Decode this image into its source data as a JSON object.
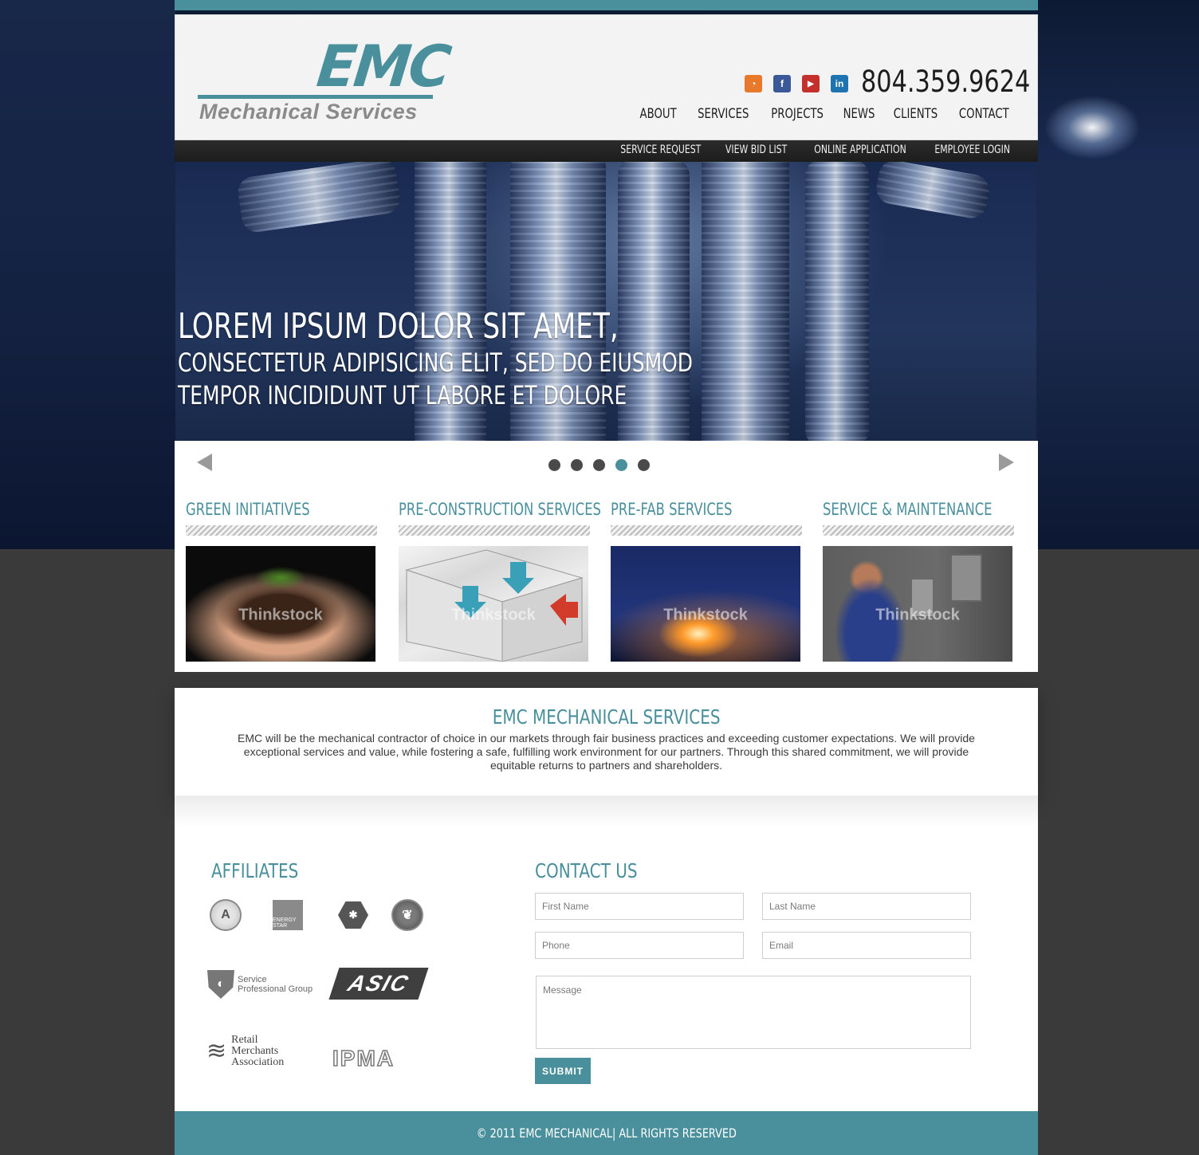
{
  "brand": {
    "logo_main": "EMC",
    "logo_sub": "Mechanical Services",
    "accent_color": "#4a8f9c"
  },
  "header": {
    "phone": "804.359.9624",
    "social": [
      {
        "icon": "rss-icon",
        "glyph": "◔",
        "color": "#e8782a"
      },
      {
        "icon": "facebook-icon",
        "glyph": "f",
        "color": "#3b5998"
      },
      {
        "icon": "youtube-icon",
        "glyph": "▶",
        "color": "#c4302b"
      },
      {
        "icon": "linkedin-icon",
        "glyph": "in",
        "color": "#1d74b0"
      }
    ]
  },
  "main_nav": [
    "ABOUT",
    "SERVICES",
    "PROJECTS",
    "NEWS",
    "CLIENTS",
    "CONTACT"
  ],
  "sub_nav": [
    "SERVICE REQUEST",
    "VIEW BID LIST",
    "ONLINE APPLICATION",
    "EMPLOYEE LOGIN"
  ],
  "hero": {
    "line1": "LOREM IPSUM DOLOR SIT AMET,",
    "line2": "CONSECTETUR ADIPISICING ELIT, SED DO EIUSMOD",
    "line3": "TEMPOR INCIDIDUNT UT LABORE ET DOLORE"
  },
  "slider": {
    "total": 5,
    "active_index": 3
  },
  "services": [
    {
      "title": "GREEN INITIATIVES",
      "image": "seedling-in-hands"
    },
    {
      "title": "PRE-CONSTRUCTION SERVICES",
      "image": "building-cutaway-diagram"
    },
    {
      "title": "PRE-FAB SERVICES",
      "image": "welding-sparks"
    },
    {
      "title": "SERVICE & MAINTENANCE",
      "image": "technician-electric-meter"
    }
  ],
  "watermark": "Thinkstock",
  "mission": {
    "title": "EMC MECHANICAL SERVICES",
    "text": "EMC will be the mechanical contractor of choice in our markets through fair business practices and exceeding customer expectations. We will provide exceptional services and value, while fostering a safe, fulfilling work environment for our partners. Through this shared commitment, we will provide equitable returns to partners and shareholders."
  },
  "affiliates": {
    "title": "AFFILIATES",
    "logos": {
      "energy_star": "ENERGY STAR",
      "spg": "Service Professional Group",
      "asic": "ASIC",
      "rma": [
        "Retail",
        "Merchants",
        "Association"
      ],
      "ipma": "IPMA"
    }
  },
  "contact": {
    "title": "CONTACT US",
    "first_name_placeholder": "First Name",
    "last_name_placeholder": "Last Name",
    "phone_placeholder": "Phone",
    "email_placeholder": "Email",
    "message_placeholder": "Message",
    "submit_label": "SUBMIT"
  },
  "footer": {
    "text": "© 2011 EMC MECHANICAL| ALL RIGHTS RESERVED"
  }
}
